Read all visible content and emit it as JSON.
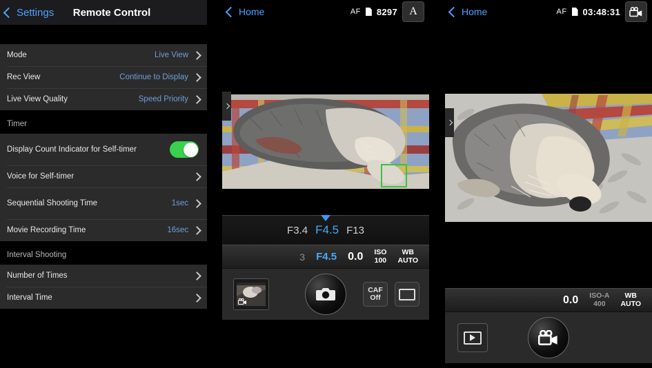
{
  "settings": {
    "back_label": "Settings",
    "title": "Remote Control",
    "groups": [
      {
        "rows": [
          {
            "label": "Mode",
            "value": "Live View",
            "accessory": "chevron"
          },
          {
            "label": "Rec View",
            "value": "Continue to Display",
            "accessory": "chevron"
          },
          {
            "label": "Live View Quality",
            "value": "Speed Priority",
            "accessory": "chevron"
          }
        ]
      }
    ],
    "section_timer": "Timer",
    "timer_rows": [
      {
        "label": "Display Count Indicator for Self-timer",
        "value": "",
        "accessory": "toggle",
        "toggle_on": true
      },
      {
        "label": "Voice for Self-timer",
        "value": "",
        "accessory": "chevron"
      },
      {
        "label": "Sequential Shooting Time",
        "value": "1sec",
        "accessory": "chevron"
      },
      {
        "label": "Movie Recording Time",
        "value": "16sec",
        "accessory": "chevron"
      }
    ],
    "section_interval": "Interval Shooting",
    "interval_rows": [
      {
        "label": "Number of Times",
        "value": "",
        "accessory": "chevron"
      },
      {
        "label": "Interval Time",
        "value": "",
        "accessory": "chevron"
      }
    ],
    "accent_blue": "#4da2ff",
    "value_blue": "#6f9fd8",
    "toggle_green": "#3ad14f"
  },
  "live": {
    "back_label": "Home",
    "af_label": "AF",
    "counter": "8297",
    "mode_badge": "A",
    "aperture_strip": {
      "left": "F3.4",
      "selected": "F4.5",
      "right": "F13"
    },
    "status": {
      "count": "3",
      "aperture": "F4.5",
      "exposure": "0.0",
      "iso_label": "ISO",
      "iso_value": "100",
      "wb_label": "WB",
      "wb_value": "AUTO"
    },
    "toolbar": {
      "thumbnail_name": "last-capture-thumbnail",
      "shutter_name": "shutter-button",
      "caf_line1": "CAF",
      "caf_line2": "Off",
      "display_toggle_name": "display-frame-button"
    },
    "focus_box_visible": true,
    "side_tab_icon": "chevron-right-icon"
  },
  "movie": {
    "back_label": "Home",
    "af_label": "AF",
    "timecode": "03:48:31",
    "mode_badge_icon": "movie-camera-icon",
    "status": {
      "exposure": "0.0",
      "iso_label": "ISO-A",
      "iso_value": "400",
      "wb_label": "WB",
      "wb_value": "AUTO"
    },
    "toolbar": {
      "playback_name": "playback-button",
      "record_name": "movie-record-button"
    },
    "side_tab_icon": "chevron-right-icon"
  }
}
